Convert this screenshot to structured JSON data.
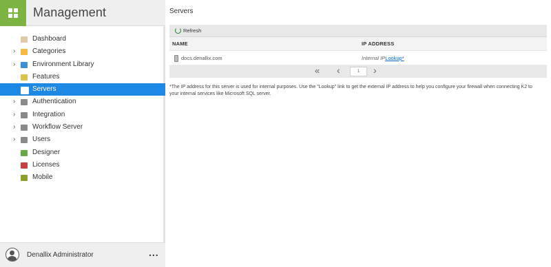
{
  "sidebar": {
    "title": "Management",
    "items": [
      {
        "label": "Dashboard",
        "icon": "dashboard-icon",
        "expandable": false,
        "active": false,
        "color": "#e0c9a6"
      },
      {
        "label": "Categories",
        "icon": "folder-icon",
        "expandable": true,
        "active": false,
        "color": "#f4b942"
      },
      {
        "label": "Environment Library",
        "icon": "library-icon",
        "expandable": true,
        "active": false,
        "color": "#3d8fd6"
      },
      {
        "label": "Features",
        "icon": "features-icon",
        "expandable": false,
        "active": false,
        "color": "#d9c34b"
      },
      {
        "label": "Servers",
        "icon": "server-icon",
        "expandable": false,
        "active": true,
        "color": "#ffffff"
      },
      {
        "label": "Authentication",
        "icon": "key-icon",
        "expandable": true,
        "active": false,
        "color": "#8a8a8a"
      },
      {
        "label": "Integration",
        "icon": "puzzle-icon",
        "expandable": true,
        "active": false,
        "color": "#8a8a8a"
      },
      {
        "label": "Workflow Server",
        "icon": "workflow-server-icon",
        "expandable": true,
        "active": false,
        "color": "#8a8a8a"
      },
      {
        "label": "Users",
        "icon": "user-icon",
        "expandable": true,
        "active": false,
        "color": "#8a8a8a"
      },
      {
        "label": "Designer",
        "icon": "designer-icon",
        "expandable": false,
        "active": false,
        "color": "#6aa843"
      },
      {
        "label": "Licenses",
        "icon": "license-ribbon-icon",
        "expandable": false,
        "active": false,
        "color": "#c94040"
      },
      {
        "label": "Mobile",
        "icon": "mobile-icon",
        "expandable": false,
        "active": false,
        "color": "#8aa02a"
      }
    ],
    "user": {
      "name": "Denallix Administrator",
      "more": "..."
    }
  },
  "main": {
    "title": "Servers",
    "toolbar": {
      "refresh_label": "Refresh"
    },
    "columns": [
      "NAME",
      "IP ADDRESS"
    ],
    "rows": [
      {
        "name": "docs.denallix.com",
        "ip_label": "Internal IP",
        "ip_link": "Lookup*"
      }
    ],
    "pager": {
      "first": "«",
      "prev": "‹",
      "page": "1",
      "next": "›"
    },
    "note": "*The IP address for this server is used for internal purposes. Use the \"Lookup\" link to get the external IP address to help you configure your firewall when connecting K2 to your internal services like Microsoft SQL server."
  },
  "colors": {
    "accent": "#1e88e5",
    "logo": "#7cb342"
  }
}
